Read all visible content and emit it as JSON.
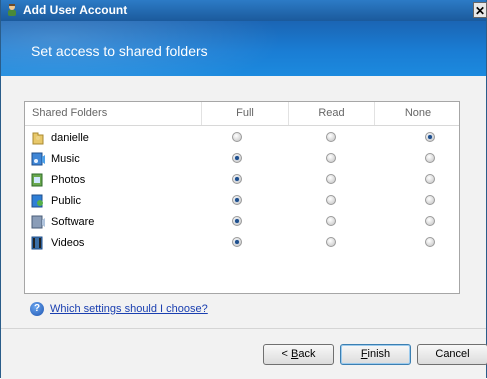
{
  "window": {
    "title": "Add User Account",
    "close_glyph": "✕"
  },
  "banner": {
    "heading": "Set access to shared folders"
  },
  "table": {
    "columns": [
      "Shared Folders",
      "Full",
      "Read",
      "None"
    ],
    "rows": [
      {
        "name": "danielle",
        "icon": "user-folder-icon",
        "access": "None"
      },
      {
        "name": "Music",
        "icon": "music-folder-icon",
        "access": "Full"
      },
      {
        "name": "Photos",
        "icon": "photos-folder-icon",
        "access": "Full"
      },
      {
        "name": "Public",
        "icon": "public-folder-icon",
        "access": "Full"
      },
      {
        "name": "Software",
        "icon": "software-folder-icon",
        "access": "Full"
      },
      {
        "name": "Videos",
        "icon": "videos-folder-icon",
        "access": "Full"
      }
    ]
  },
  "help": {
    "link_text": "Which settings should I choose?"
  },
  "buttons": {
    "back": {
      "prefix": "< ",
      "mnemonic": "B",
      "rest": "ack"
    },
    "finish": {
      "mnemonic": "F",
      "rest": "inish"
    },
    "cancel": {
      "label": "Cancel"
    }
  },
  "colors": {
    "accent": "#1a7dd4",
    "link": "#1a3fb0"
  }
}
